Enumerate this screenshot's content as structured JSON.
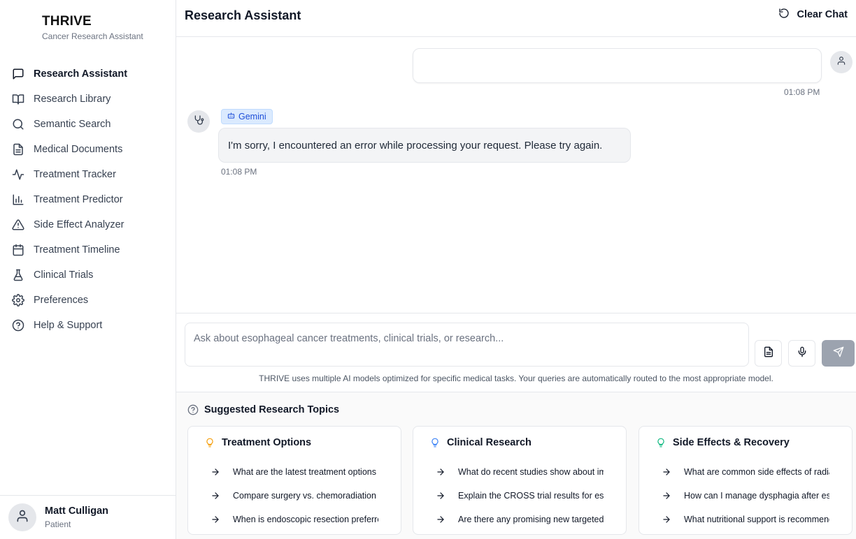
{
  "sidebar": {
    "brand": {
      "title": "THRIVE",
      "subtitle": "Cancer Research Assistant"
    },
    "items": [
      {
        "label": "Research Assistant",
        "icon": "chat-icon"
      },
      {
        "label": "Research Library",
        "icon": "book-icon"
      },
      {
        "label": "Semantic Search",
        "icon": "search-icon"
      },
      {
        "label": "Medical Documents",
        "icon": "document-icon"
      },
      {
        "label": "Treatment Tracker",
        "icon": "activity-icon"
      },
      {
        "label": "Treatment Predictor",
        "icon": "bar-chart-icon"
      },
      {
        "label": "Side Effect Analyzer",
        "icon": "warning-icon"
      },
      {
        "label": "Treatment Timeline",
        "icon": "calendar-icon"
      },
      {
        "label": "Clinical Trials",
        "icon": "flask-icon"
      },
      {
        "label": "Preferences",
        "icon": "gear-icon"
      },
      {
        "label": "Help & Support",
        "icon": "help-icon"
      }
    ],
    "active_item": "Research Assistant",
    "user": {
      "name": "Matt Culligan",
      "role": "Patient"
    }
  },
  "header": {
    "title": "Research Assistant",
    "clear_label": "Clear Chat"
  },
  "chat": {
    "messages": [
      {
        "role": "user",
        "text": "",
        "time": "01:08 PM"
      },
      {
        "role": "assistant",
        "model": "Gemini",
        "text": "I'm sorry, I encountered an error while processing your request. Please try again.",
        "time": "01:08 PM"
      }
    ]
  },
  "composer": {
    "placeholder": "Ask about esophageal cancer treatments, clinical trials, or research...",
    "note": "THRIVE uses multiple AI models optimized for specific medical tasks. Your queries are automatically routed to the most appropriate model."
  },
  "suggestions": {
    "title": "Suggested Research Topics",
    "cards": [
      {
        "title": "Treatment Options",
        "accent": "#f59e0b",
        "questions": [
          "What are the latest treatment options fo",
          "Compare surgery vs. chemoradiation fo",
          "When is endoscopic resection preferrec"
        ]
      },
      {
        "title": "Clinical Research",
        "accent": "#3b82f6",
        "questions": [
          "What do recent studies show about imr",
          "Explain the CROSS trial results for esopl",
          "Are there any promising new targeted t"
        ]
      },
      {
        "title": "Side Effects & Recovery",
        "accent": "#10b981",
        "questions": [
          "What are common side effects of radiat",
          "How can I manage dysphagia after esop",
          "What nutritional support is recommend"
        ]
      }
    ]
  },
  "colors": {
    "send_disabled": "#9ca3af",
    "badge_bg": "#dbeafe",
    "badge_text": "#1d4ed8"
  }
}
